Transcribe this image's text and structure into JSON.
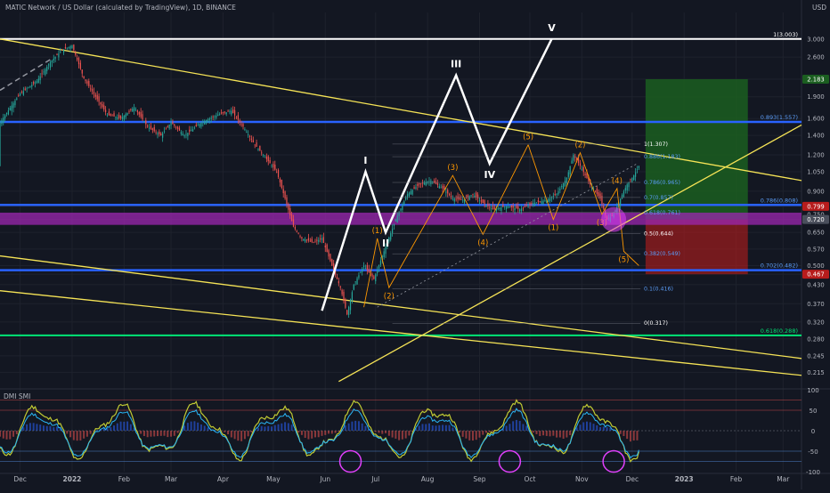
{
  "header": {
    "symbol_title": "MATIC Network / US Dollar (calculated by TradingView), 1D, BINANCE",
    "currency": "USD",
    "indicator_label": "DMI SMI"
  },
  "colors": {
    "background": "#131722",
    "axis_text": "#b2b5be",
    "grid": "#1e222d",
    "up_candle": "#26a69a",
    "down_candle": "#ef5350",
    "trendline_yellow": "#f5e356",
    "level_blue": "#2962ff",
    "level_green": "#00e676",
    "purple_zone": "#9c27b0",
    "wave_white": "#ffffff",
    "wave_orange": "#ff9800",
    "fib_blue": "#5b9cf6",
    "target_green": "#1b5e20",
    "stop_red": "#b71c1c",
    "circle_magenta": "#e040fb"
  },
  "chart_data": {
    "type": "candlestick",
    "title": "MATIC Network / US Dollar (calculated by TradingView), 1D, BINANCE",
    "x_labels": [
      "Dec",
      "2022",
      "Feb",
      "Mar",
      "Apr",
      "May",
      "Jun",
      "Jul",
      "Aug",
      "Sep",
      "Oct",
      "Nov",
      "Dec",
      "2023",
      "Feb",
      "Mar"
    ],
    "x_label_days": [
      0,
      31,
      62,
      90,
      121,
      151,
      182,
      212,
      243,
      274,
      304,
      335,
      365,
      396,
      427,
      455
    ],
    "x_range_days": [
      -12,
      466
    ],
    "y_scale": "log",
    "y_range": [
      0.19,
      3.7
    ],
    "y_ticks": [
      "3.000",
      "2.600",
      "2.183",
      "1.900",
      "1.600",
      "1.400",
      "1.200",
      "1.050",
      "0.900",
      "0.799",
      "0.750",
      "0.720",
      "0.650",
      "0.570",
      "0.500",
      "0.467",
      "0.430",
      "0.370",
      "0.320",
      "0.280",
      "0.245",
      "0.215"
    ],
    "y_tick_values": [
      3.0,
      2.6,
      2.183,
      1.9,
      1.6,
      1.4,
      1.2,
      1.05,
      0.9,
      0.799,
      0.75,
      0.72,
      0.65,
      0.57,
      0.5,
      0.467,
      0.43,
      0.37,
      0.32,
      0.28,
      0.245,
      0.215
    ],
    "price_badges": [
      {
        "label": "2.183",
        "value": 2.183,
        "color": "#1b5e20"
      },
      {
        "label": "0.799",
        "value": 0.799,
        "color": "#b71c1c"
      },
      {
        "label": "0.720",
        "value": 0.72,
        "color": "#4a4f5c"
      },
      {
        "label": "0.467",
        "value": 0.467,
        "color": "#b71c1c"
      }
    ],
    "price_path": [
      [
        -12,
        1.55
      ],
      [
        0,
        1.95
      ],
      [
        10,
        2.15
      ],
      [
        18,
        2.5
      ],
      [
        25,
        2.75
      ],
      [
        31,
        2.85
      ],
      [
        38,
        2.2
      ],
      [
        45,
        1.9
      ],
      [
        52,
        1.65
      ],
      [
        60,
        1.6
      ],
      [
        68,
        1.75
      ],
      [
        76,
        1.5
      ],
      [
        84,
        1.4
      ],
      [
        90,
        1.55
      ],
      [
        98,
        1.4
      ],
      [
        108,
        1.55
      ],
      [
        118,
        1.65
      ],
      [
        126,
        1.7
      ],
      [
        133,
        1.5
      ],
      [
        140,
        1.3
      ],
      [
        146,
        1.18
      ],
      [
        153,
        1.05
      ],
      [
        158,
        0.85
      ],
      [
        163,
        0.68
      ],
      [
        168,
        0.62
      ],
      [
        175,
        0.6
      ],
      [
        180,
        0.62
      ],
      [
        186,
        0.5
      ],
      [
        191,
        0.42
      ],
      [
        195,
        0.34
      ],
      [
        199,
        0.43
      ],
      [
        205,
        0.5
      ],
      [
        211,
        0.45
      ],
      [
        217,
        0.56
      ],
      [
        224,
        0.72
      ],
      [
        231,
        0.88
      ],
      [
        238,
        0.95
      ],
      [
        245,
        0.98
      ],
      [
        252,
        0.92
      ],
      [
        258,
        0.85
      ],
      [
        264,
        0.84
      ],
      [
        270,
        0.88
      ],
      [
        276,
        0.82
      ],
      [
        282,
        0.78
      ],
      [
        290,
        0.8
      ],
      [
        298,
        0.78
      ],
      [
        306,
        0.82
      ],
      [
        314,
        0.84
      ],
      [
        320,
        0.88
      ],
      [
        326,
        1.0
      ],
      [
        330,
        1.2
      ],
      [
        334,
        1.1
      ],
      [
        340,
        0.95
      ],
      [
        346,
        0.85
      ],
      [
        350,
        0.72
      ],
      [
        354,
        0.75
      ],
      [
        358,
        0.85
      ],
      [
        362,
        0.95
      ],
      [
        366,
        1.02
      ],
      [
        369,
        1.1
      ]
    ],
    "horizontal_levels": [
      {
        "value": 3.0,
        "color": "#ffffff",
        "label": "1(3.003)"
      },
      {
        "value": 1.557,
        "color": "#2962ff",
        "label": "0.893(1.557)"
      },
      {
        "value": 0.808,
        "color": "#2962ff",
        "label": "0.786(0.808)"
      },
      {
        "value": 0.482,
        "color": "#2962ff",
        "label": "0.702(0.482)"
      },
      {
        "value": 0.288,
        "color": "#00e676",
        "label": "0.618(0.288)"
      }
    ],
    "purple_zone": [
      0.69,
      0.76
    ],
    "fib_levels": [
      {
        "label": "1(1.307)",
        "value": 1.307
      },
      {
        "label": "0.886(1.183)",
        "value": 1.183
      },
      {
        "label": "0.786(0.965)",
        "value": 0.965
      },
      {
        "label": "0.7(0.857)",
        "value": 0.857
      },
      {
        "label": "0.618(0.761)",
        "value": 0.761
      },
      {
        "label": "0.5(0.644)",
        "value": 0.644
      },
      {
        "label": "0.382(0.549)",
        "value": 0.549
      },
      {
        "label": "0.1(0.416)",
        "value": 0.416
      },
      {
        "label": "0(0.317)",
        "value": 0.317
      }
    ],
    "trendlines": [
      {
        "from": [
          -12,
          3.0
        ],
        "to": [
          466,
          0.98
        ],
        "color": "#f5e356"
      },
      {
        "from": [
          -12,
          0.54
        ],
        "to": [
          466,
          0.24
        ],
        "color": "#f5e356"
      },
      {
        "from": [
          -12,
          0.41
        ],
        "to": [
          466,
          0.21
        ],
        "color": "#f5e356"
      },
      {
        "from": [
          190,
          0.2
        ],
        "to": [
          466,
          1.52
        ],
        "color": "#f5e356"
      }
    ],
    "major_waves": {
      "points": [
        [
          180,
          0.35
        ],
        [
          206,
          1.05
        ],
        [
          218,
          0.65
        ],
        [
          260,
          2.25
        ],
        [
          280,
          1.12
        ],
        [
          317,
          3.0
        ]
      ],
      "labels": [
        "I",
        "II",
        "III",
        "IV",
        "V"
      ]
    },
    "minor_waves": {
      "points": [
        [
          205,
          0.36
        ],
        [
          213,
          0.62
        ],
        [
          220,
          0.42
        ],
        [
          258,
          1.02
        ],
        [
          276,
          0.64
        ],
        [
          303,
          1.3
        ],
        [
          318,
          0.72
        ],
        [
          334,
          1.22
        ],
        [
          347,
          0.75
        ],
        [
          356,
          0.92
        ],
        [
          360,
          0.56
        ],
        [
          369,
          0.5
        ]
      ],
      "labels": [
        "(1)",
        "(2)",
        "(3)",
        "(4)",
        "(5)",
        "(1)",
        "(2)",
        "(3)",
        "(4)",
        "(5)"
      ]
    },
    "position_box": {
      "day_from": 373,
      "day_to": 434,
      "entry": 0.72,
      "target": 2.183,
      "stop": 0.467
    },
    "indicator": {
      "name": "DMI SMI",
      "y_ticks": [
        100,
        50,
        0,
        -50,
        -100
      ],
      "y_range": [
        -100,
        100
      ],
      "bands": [
        75,
        50,
        -50,
        -75
      ],
      "circle_days": [
        197,
        292,
        354
      ]
    }
  }
}
